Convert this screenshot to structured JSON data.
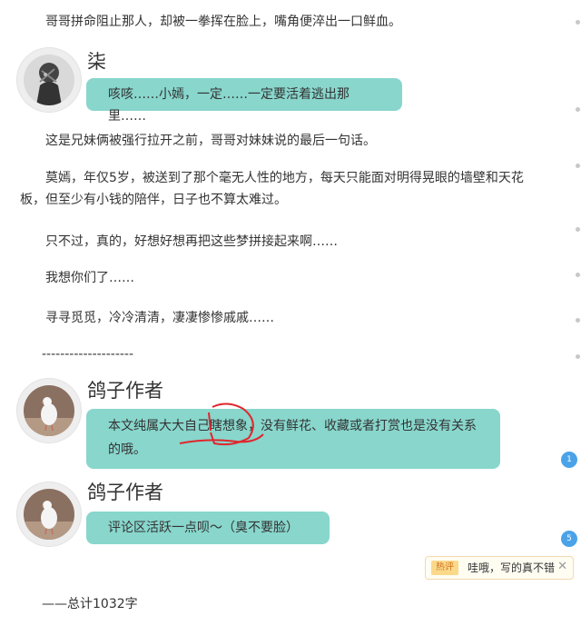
{
  "story": {
    "para_top": "哥哥拼命阻止那人，却被一拳挥在脸上，嘴角便淬出一口鲜血。",
    "para1": "这是兄妹俩被强行拉开之前，哥哥对妹妹说的最后一句话。",
    "para2": "莫嫣，年仅5岁，被送到了那个毫无人性的地方，每天只能面对明得晃眼的墙壁和天花板，但至少有小钱的陪伴，日子也不算太难过。",
    "para3": "只不过，真的，好想好想再把这些梦拼接起来啊……",
    "para4": "我想你们了……",
    "para5": "寻寻觅觅，冷冷清清，凄凄惨惨戚戚……",
    "divider": "--------------------",
    "total": "——总计1032字"
  },
  "dialogs": [
    {
      "speaker": "柒",
      "text": "咳咳……小嫣，一定……一定要活着逃出那里……"
    },
    {
      "speaker": "鸽子作者",
      "text": "本文纯属大大自己瞎想象，没有鲜花、收藏或者打赏也是没有关系的哦。"
    },
    {
      "speaker": "鸽子作者",
      "text": "评论区活跃一点呗～（臭不要脸）"
    }
  ],
  "comments": {
    "badge_1": "1",
    "badge_2": "5",
    "hot_tag": "热评",
    "hot_text": "哇哦，写的真不错",
    "close": "✕"
  },
  "colors": {
    "bubble": "#88d6cc",
    "badge": "#4aa3e8",
    "annotation": "#e0262d"
  }
}
